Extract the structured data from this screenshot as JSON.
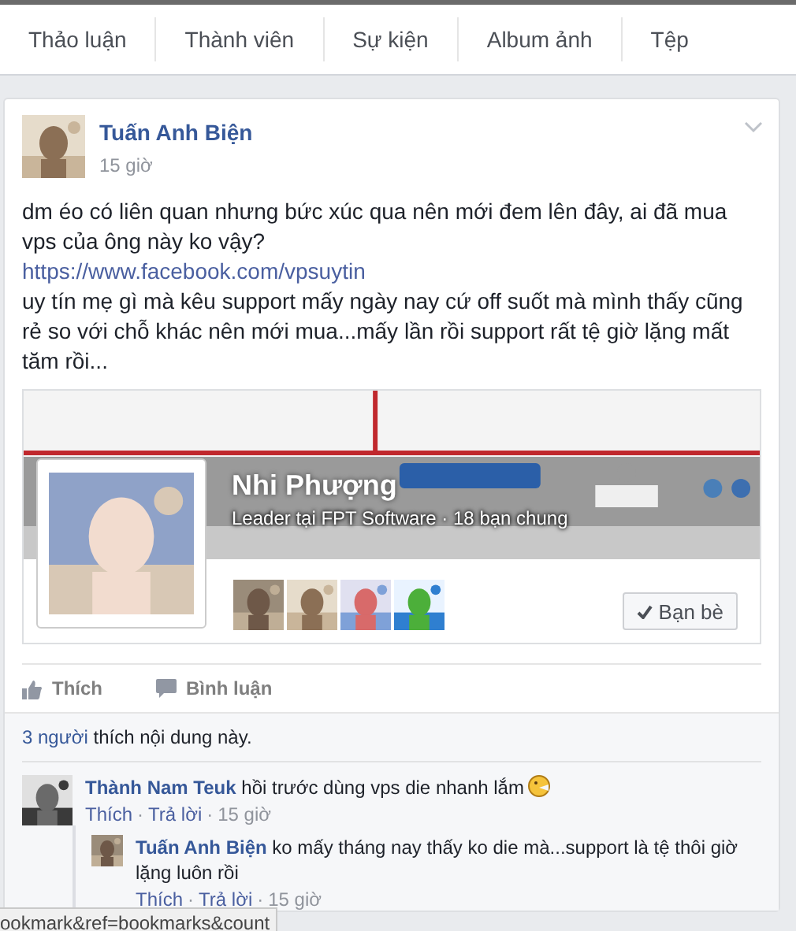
{
  "tabs": [
    {
      "label": "Thảo luận",
      "selected": false
    },
    {
      "label": "Thành viên",
      "selected": false
    },
    {
      "label": "Sự kiện",
      "selected": false
    },
    {
      "label": "Album ảnh",
      "selected": false
    },
    {
      "label": "Tệp",
      "selected": false
    }
  ],
  "post": {
    "author": "Tuấn Anh Biện",
    "time": "15 giờ",
    "paragraphs": [
      {
        "kind": "text",
        "text": "dm éo có liên quan nhưng bức xúc qua nên mới đem lên đây, ai đã mua vps của ông này ko vậy?"
      },
      {
        "kind": "link",
        "text": "https://www.facebook.com/vpsuytin"
      },
      {
        "kind": "text",
        "text": "uy tín mẹ gì mà kêu support mấy ngày nay cứ off suốt mà mình thấy cũng rẻ so với chỗ khác nên mới mua...mấy lần rồi support rất tệ giờ lặng mất tăm rồi..."
      }
    ],
    "profile_card": {
      "name": "Nhi Phượng",
      "subtitle": "Leader tại FPT Software · 18 bạn chung",
      "friend_button": "Bạn bè",
      "is_friend": true
    },
    "actions": [
      "Thích",
      "Bình luận"
    ],
    "likes": {
      "count": "3 người",
      "text": "thích nội dung này."
    },
    "separator": "·",
    "comments": [
      {
        "author": "Thành Nam Teuk",
        "text": "hồi trước dùng vps die nhanh lắm",
        "emoji": true,
        "links": [
          "Thích",
          "Trả lời"
        ],
        "time": "15 giờ",
        "replies": [
          {
            "author": "Tuấn Anh Biện",
            "text": "ko mấy tháng nay thấy ko die mà...support là tệ thôi giờ lặng luôn rồi",
            "emoji": false,
            "links": [
              "Thích",
              "Trả lời"
            ],
            "time": "15 giờ"
          }
        ]
      }
    ]
  },
  "status_bar": {
    "url": "ookmark&ref=bookmarks&count"
  }
}
